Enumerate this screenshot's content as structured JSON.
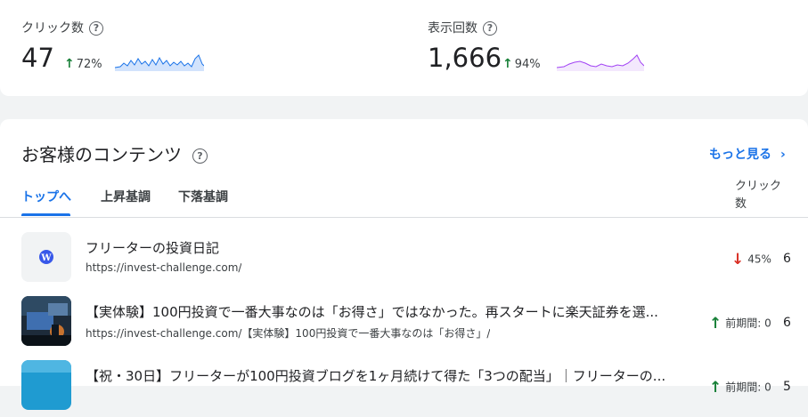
{
  "metrics": [
    {
      "label": "クリック数",
      "value": "47",
      "change": "72%",
      "direction": "up",
      "spark_color": "#1a73e8"
    },
    {
      "label": "表示回数",
      "value": "1,666",
      "change": "94%",
      "direction": "up",
      "spark_color": "#a142f4"
    }
  ],
  "content": {
    "title": "お客様のコンテンツ",
    "more_link": "もっと見る",
    "tabs": [
      "トップへ",
      "上昇基調",
      "下落基調"
    ],
    "active_tab": "トップへ",
    "column_header": "クリック数",
    "rows": [
      {
        "title": "フリーターの投資日記",
        "url": "https://invest-challenge.com/",
        "change": "45%",
        "direction": "down",
        "clicks": "6",
        "thumb": "wordpress-icon"
      },
      {
        "title": "【実体験】100円投資で一番大事なのは「お得さ」ではなかった。再スタートに楽天証券を選...",
        "url": "https://invest-challenge.com/【実体験】100円投資で一番大事なのは「お得さ」/",
        "change": "前期間: 0",
        "direction": "up",
        "clicks": "6",
        "thumb": "photo-thumbnail"
      },
      {
        "title": "【祝・30日】フリーターが100円投資ブログを1ヶ月続けて得た「3つの配当」｜フリーターの...",
        "url": "",
        "change": "前期間: 0",
        "direction": "up",
        "clicks": "5",
        "thumb": "photo-thumbnail"
      }
    ]
  },
  "colors": {
    "accent": "#1a73e8",
    "up": "#188038",
    "down": "#d93025"
  }
}
